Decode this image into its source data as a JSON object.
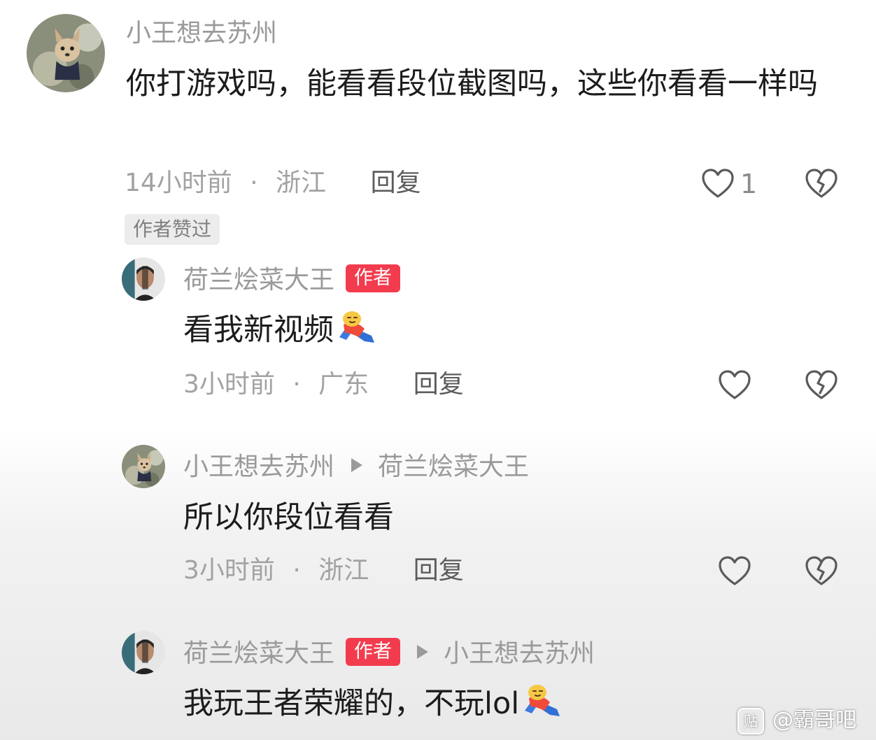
{
  "comments": [
    {
      "user": "小王想去苏州",
      "text": "你打游戏吗，能看看段位截图吗，这些你看看一样吗",
      "time": "14小时前",
      "location": "浙江",
      "reply": "回复",
      "likes": "1",
      "liked_by_author": "作者赞过"
    },
    {
      "user": "荷兰烩菜大王",
      "author_tag": "作者",
      "text": "看我新视频",
      "time": "3小时前",
      "location": "广东",
      "reply": "回复"
    },
    {
      "user": "小王想去苏州",
      "reply_to": "荷兰烩菜大王",
      "text": "所以你段位看看",
      "time": "3小时前",
      "location": "浙江",
      "reply": "回复"
    },
    {
      "user": "荷兰烩菜大王",
      "author_tag": "作者",
      "reply_to": "小王想去苏州",
      "text": "我玩王者荣耀的，不玩lol"
    }
  ],
  "separator": "·",
  "watermark": {
    "icon_text": "贴",
    "text": "@霸哥吧"
  },
  "colors": {
    "author_tag": "#f23c4e",
    "name": "#9a9a9a",
    "meta": "#a2a2a2"
  },
  "icons": [
    "heart-outline-icon",
    "broken-heart-icon",
    "sticker-emoji-icon",
    "avatar-dog",
    "avatar-man"
  ]
}
